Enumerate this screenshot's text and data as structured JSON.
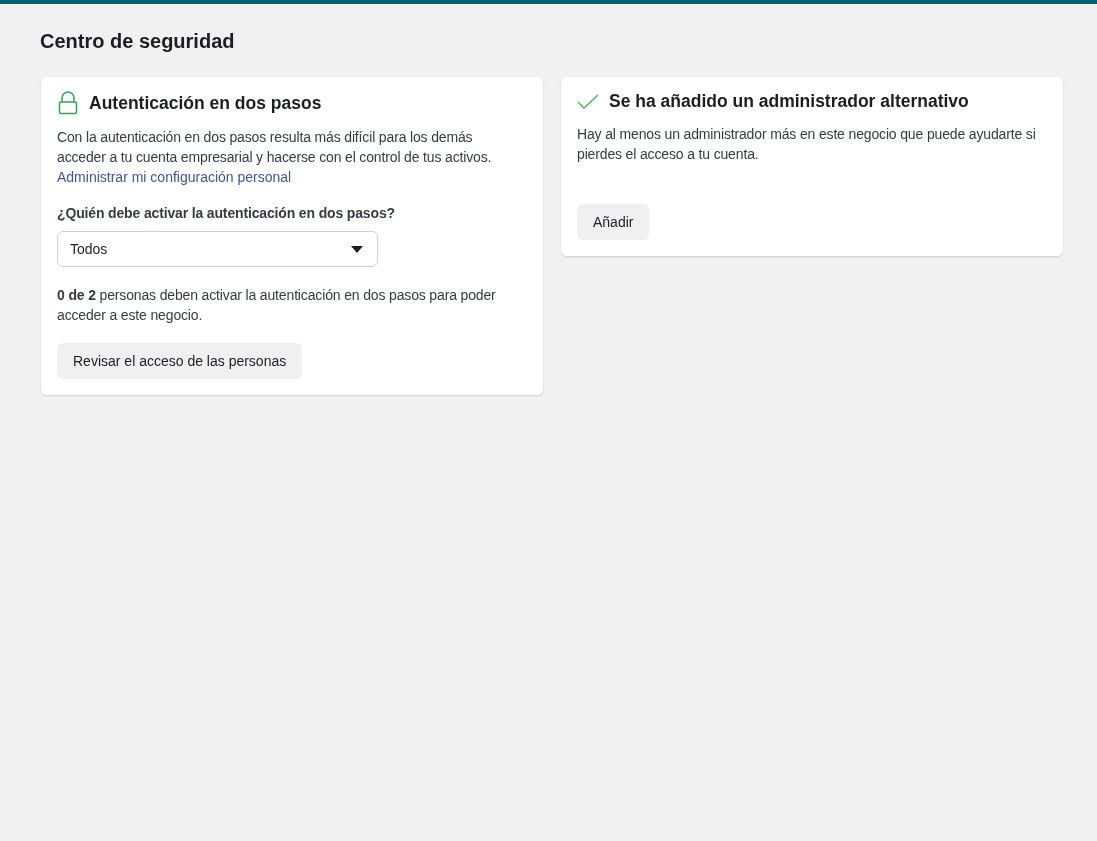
{
  "page": {
    "title": "Centro de seguridad"
  },
  "cards": [
    {
      "kind": "lock",
      "title": "Autenticación en dos pasos",
      "description": "Con la autenticación en dos pasos resulta más difícil para los demás acceder a tu cuenta empresarial y hacerse con el control de tus activos.",
      "link": "Administrar mi configuración personal",
      "field": {
        "label": "¿Quién debe activar la autenticación en dos pasos?",
        "value": "Todos"
      },
      "note": "**0 de 2** personas deben activar la autenticación en dos pasos para poder acceder a este negocio.",
      "button": "Revisar el acceso de las personas"
    },
    {
      "kind": "check",
      "title": "Se ha añadido un administrador alternativo",
      "description": "Hay al menos un administrador más en este negocio que puede ayudarte si pierdes el acceso a tu cuenta.",
      "button": "Añadir"
    }
  ]
}
